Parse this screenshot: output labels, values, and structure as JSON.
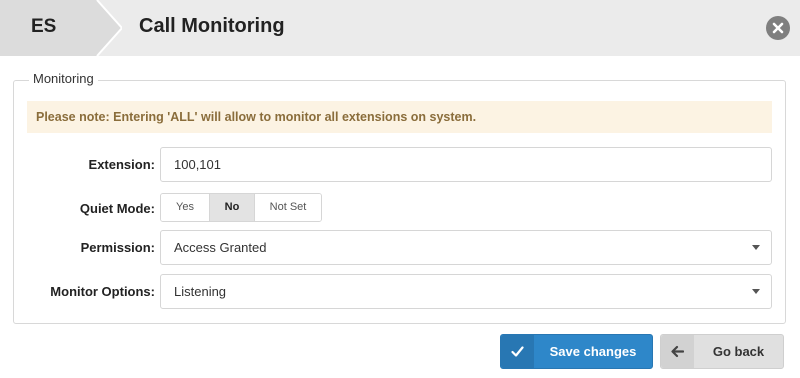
{
  "header": {
    "breadcrumb_root": "ES",
    "title": "Call Monitoring",
    "close_icon": "close-icon"
  },
  "form": {
    "legend": "Monitoring",
    "notice": "Please note: Entering 'ALL' will allow to monitor all extensions on system.",
    "extension": {
      "label": "Extension:",
      "value": "100,101"
    },
    "quiet_mode": {
      "label": "Quiet Mode:",
      "options": [
        "Yes",
        "No",
        "Not Set"
      ],
      "selected": "No"
    },
    "permission": {
      "label": "Permission:",
      "value": "Access Granted"
    },
    "monitor_options": {
      "label": "Monitor Options:",
      "value": "Listening"
    }
  },
  "actions": {
    "save_label": "Save changes",
    "save_icon": "check-icon",
    "back_label": "Go back",
    "back_icon": "arrow-left-icon"
  },
  "colors": {
    "primary": "#2e87c9",
    "notice_bg": "#fcf3e3",
    "notice_text": "#8a6d3b",
    "header_bg": "#ebebeb"
  }
}
